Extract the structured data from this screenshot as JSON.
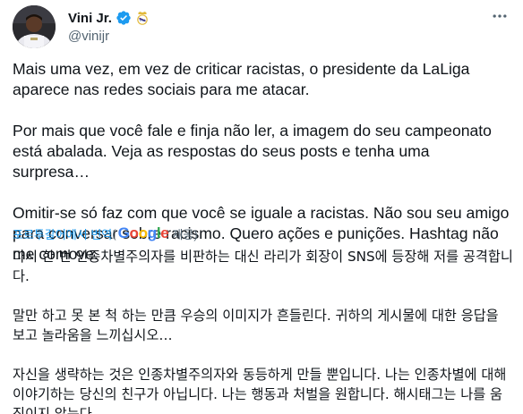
{
  "user": {
    "display_name": "Vini Jr.",
    "handle": "@vinijr",
    "verified": true
  },
  "tweet": {
    "paragraphs": [
      "Mais uma vez, em vez de criticar racistas, o presidente da LaLiga aparece nas redes sociais para me atacar.",
      "Por mais que você fale e finja não ler, a imagem do seu campeonato está abalada. Veja as respostas do seus posts e tenha uma surpresa…",
      "Omitir-se só faz com que você se iguale a racistas. Não sou seu amigo para conversar sobre racismo. Quero ações e punições. Hashtag não me comove."
    ]
  },
  "translation": {
    "link_label": "포르투갈어에서 번역",
    "open_paren": "(",
    "provider": "Google",
    "suffix": "제공)",
    "paragraphs": [
      "다시 한 번 인종차별주의자를 비판하는 대신 라리가 회장이 SNS에 등장해 저를 공격합니다.",
      "말만 하고 못 본 척 하는 만큼 우승의 이미지가 흔들린다. 귀하의 게시물에 대한 응답을 보고 놀라움을 느끼십시오…",
      "자신을 생략하는 것은 인종차별주의자와 동등하게 만들 뿐입니다. 나는 인종차별에 대해 이야기하는 당신의 친구가 아닙니다. 나는 행동과 처벌을 원합니다. 해시태그는 나를 움직이지 않는다."
    ]
  },
  "icons": {
    "verified": "verified-badge-icon",
    "affiliate": "real-madrid-crest-icon",
    "more": "more-options-icon"
  },
  "colors": {
    "text": "#0f1419",
    "secondary": "#536471",
    "link": "#1d9bf0",
    "verified": "#1d9bf0"
  }
}
